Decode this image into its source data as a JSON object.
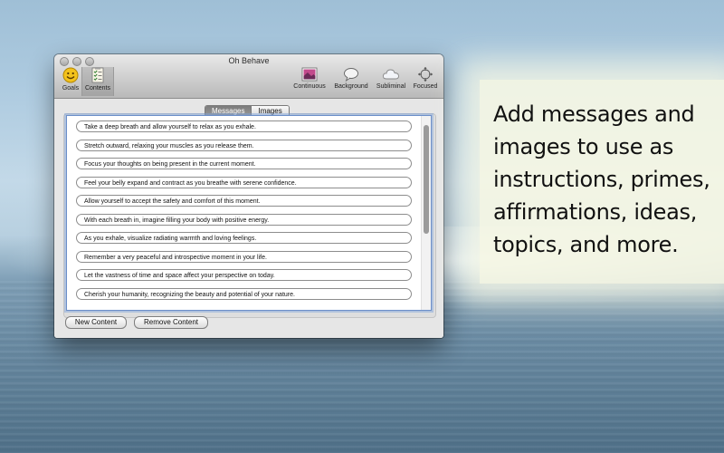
{
  "window": {
    "title": "Oh Behave"
  },
  "toolbar": {
    "left_items": [
      {
        "label": "Goals",
        "icon": "smiley-icon"
      },
      {
        "label": "Contents",
        "icon": "checklist-icon"
      }
    ],
    "right_items": [
      {
        "label": "Continuous",
        "icon": "photo-icon"
      },
      {
        "label": "Background",
        "icon": "speech-bubble-icon"
      },
      {
        "label": "Subliminal",
        "icon": "cloud-icon"
      },
      {
        "label": "Focused",
        "icon": "target-icon"
      }
    ]
  },
  "segments": {
    "messages": "Messages",
    "images": "Images",
    "selected": "Messages"
  },
  "messages": [
    "Take a deep breath and allow yourself to relax as you exhale.",
    "Stretch outward, relaxing your muscles as you release them.",
    "Focus your thoughts on being present in the current moment.",
    "Feel your belly expand and contract as you breathe with serene confidence.",
    "Allow yourself to accept the safety and comfort of this moment.",
    "With each breath in, imagine filling your body with positive energy.",
    "As you exhale, visualize radiating warmth and loving feelings.",
    "Remember a very peaceful and introspective moment in your life.",
    "Let the vastness of time and space affect your perspective on today.",
    "Cherish your humanity, recognizing the beauty and potential of your nature."
  ],
  "buttons": {
    "new_content": "New Content",
    "remove_content": "Remove Content"
  },
  "promo": {
    "lines": [
      "Add messages and",
      "images to use as",
      "instructions, primes,",
      "affirmations, ideas,",
      "topics, and more."
    ]
  }
}
